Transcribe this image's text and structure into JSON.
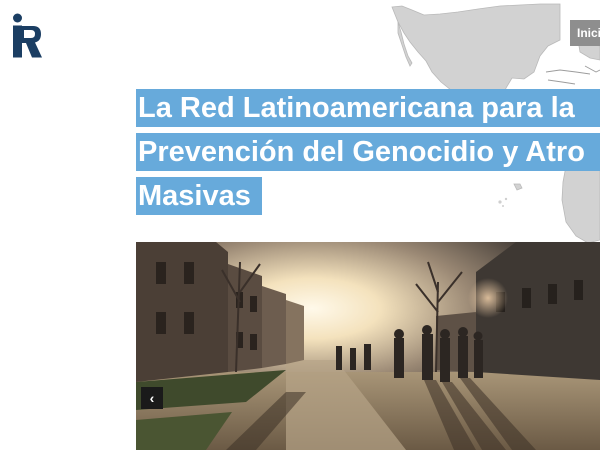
{
  "nav": {
    "inicio_label": "Inici"
  },
  "hero": {
    "title_lines": [
      "La Red Latinoamericana para la",
      "Prevención del Genocidio y Atro",
      "Masivas"
    ]
  },
  "slider": {
    "prev_icon": "chevron-left-icon",
    "prev_glyph": "‹"
  },
  "colors": {
    "title_bg": "#67aadb",
    "nav_bg": "#8e8e8e",
    "logo": "#1b3e63",
    "map": "#d1d1d1"
  }
}
